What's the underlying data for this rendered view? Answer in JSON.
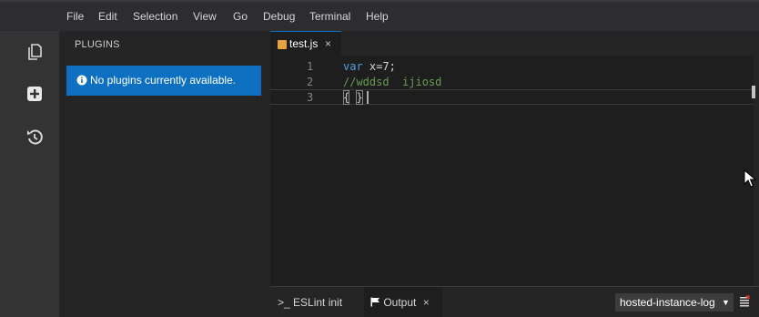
{
  "menubar": {
    "items": [
      "File",
      "Edit",
      "Selection",
      "View",
      "Go",
      "Debug",
      "Terminal",
      "Help"
    ]
  },
  "activitybar": {
    "icons": [
      "files-icon",
      "plugins-add-icon",
      "history-icon"
    ]
  },
  "sidebar": {
    "title": "PLUGINS",
    "notice": "No plugins currently available."
  },
  "editor": {
    "tab": {
      "label": "test.js",
      "close": "×"
    },
    "lines": [
      {
        "number": "1",
        "tokens": [
          {
            "text": "var",
            "type": "kw"
          },
          {
            "text": " x=7;",
            "type": "def"
          }
        ]
      },
      {
        "number": "2",
        "tokens": [
          {
            "text": "//wddsd  ijiosd",
            "type": "com"
          }
        ]
      },
      {
        "number": "3",
        "tokens": [
          {
            "text": "{",
            "type": "bracket"
          },
          {
            "text": " ",
            "type": "def"
          },
          {
            "text": "}",
            "type": "bracket"
          }
        ]
      }
    ]
  },
  "panel": {
    "tabs": [
      {
        "prefix": ">_",
        "label": "ESLint init"
      },
      {
        "label": "Output",
        "close": "×"
      }
    ],
    "select": {
      "value": "hosted-instance-log"
    }
  },
  "colors": {
    "accent": "#0e70c0",
    "keyword": "#569cd6",
    "comment": "#6a9955"
  }
}
